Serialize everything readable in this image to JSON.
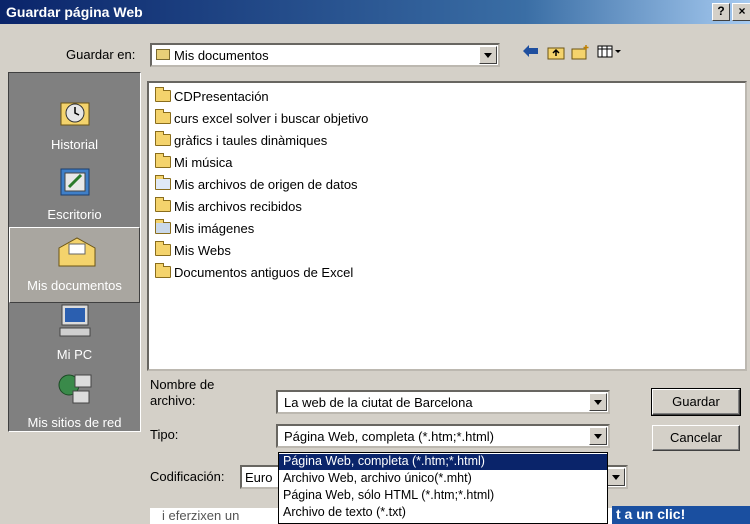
{
  "window": {
    "title": "Guardar página Web",
    "help_label": "?",
    "close_label": "×"
  },
  "save_in": {
    "label": "Guardar en:",
    "value": "Mis documentos"
  },
  "toolbar": {
    "icons": [
      "back-icon",
      "up-folder-icon",
      "new-folder-icon",
      "views-icon"
    ]
  },
  "places": [
    {
      "label": "Historial",
      "icon": "history-icon"
    },
    {
      "label": "Escritorio",
      "icon": "desktop-icon"
    },
    {
      "label": "Mis documentos",
      "icon": "my-documents-icon"
    },
    {
      "label": "Mi PC",
      "icon": "my-computer-icon"
    },
    {
      "label": "Mis sitios de red",
      "icon": "network-places-icon"
    }
  ],
  "files": [
    {
      "name": "CDPresentación",
      "icon": "folder-icon"
    },
    {
      "name": "curs excel solver i buscar objetivo",
      "icon": "folder-icon"
    },
    {
      "name": "gràfics i taules dinàmiques",
      "icon": "folder-icon"
    },
    {
      "name": "Mi música",
      "icon": "folder-icon"
    },
    {
      "name": "Mis archivos de origen de datos",
      "icon": "data-source-folder-icon"
    },
    {
      "name": "Mis archivos recibidos",
      "icon": "folder-icon"
    },
    {
      "name": "Mis imágenes",
      "icon": "pictures-folder-icon"
    },
    {
      "name": "Mis Webs",
      "icon": "folder-icon"
    },
    {
      "name": "Documentos antiguos de Excel",
      "icon": "shortcut-folder-icon"
    }
  ],
  "filename": {
    "label_line1": "Nombre de",
    "label_line2": "archivo:",
    "value": "La web de la ciutat de Barcelona"
  },
  "type": {
    "label": "Tipo:",
    "value": "Página Web, completa (*.htm;*.html)",
    "options": [
      "Página Web, completa (*.htm;*.html)",
      "Archivo Web, archivo único(*.mht)",
      "Página Web, sólo HTML (*.htm;*.html)",
      "Archivo de texto (*.txt)"
    ],
    "selected_index": 0
  },
  "encoding": {
    "label": "Codificación:",
    "value": "Euro"
  },
  "buttons": {
    "save": "Guardar",
    "cancel": "Cancelar"
  },
  "background": {
    "text_left": "i eferzixen un",
    "text_right": "t a un clic!"
  },
  "colors": {
    "titlebar": "#0a246a",
    "dialog": "#d4d0c8",
    "selection": "#0a246a",
    "places_bg": "#808080"
  }
}
